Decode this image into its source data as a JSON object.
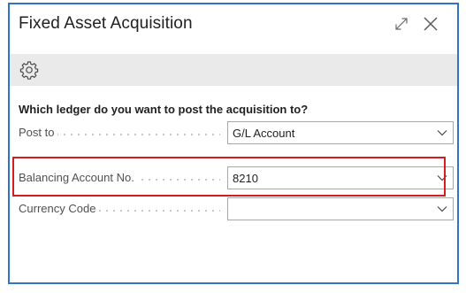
{
  "dialog": {
    "title": "Fixed Asset Acquisition",
    "icons": {
      "expand": "expand-icon",
      "close": "close-icon",
      "settings": "gear-icon",
      "dropdown": "chevron-down-icon"
    }
  },
  "form": {
    "question": "Which ledger do you want to post the acquisition to?",
    "fields": [
      {
        "label": "Post to",
        "value": "G/L Account"
      },
      {
        "label": "Balancing Account No.",
        "value": "8210"
      },
      {
        "label": "Currency Code",
        "value": ""
      }
    ]
  },
  "colors": {
    "dialog_border": "#2e75c7",
    "toolbar_bg": "#eaeaea",
    "highlight": "#d61c1c"
  }
}
